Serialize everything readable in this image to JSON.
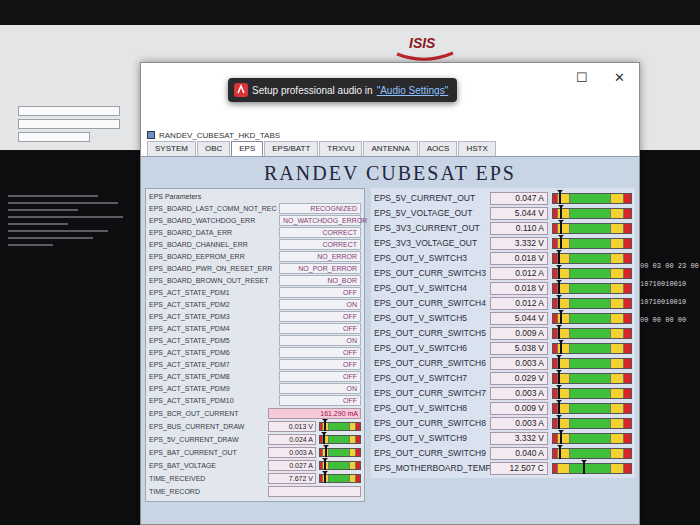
{
  "desktop": {
    "logo": "ISIS",
    "terminal_lines": [
      "00 03 00 23 00",
      "10710010010",
      "10710010010",
      "00 00 00 00"
    ]
  },
  "notification": {
    "text": "Setup professional audio in",
    "link": "\"Audio Settings\""
  },
  "window": {
    "title": "RANDEV_CUBESAT_HKD_TABS",
    "controls": [
      "☐",
      "✕"
    ]
  },
  "tabs": [
    {
      "label": "SYSTEM",
      "selected": false
    },
    {
      "label": "OBC",
      "selected": false
    },
    {
      "label": "EPS",
      "selected": true
    },
    {
      "label": "EPS/BATT",
      "selected": false
    },
    {
      "label": "TRXVU",
      "selected": false
    },
    {
      "label": "ANTENNA",
      "selected": false
    },
    {
      "label": "AOCS",
      "selected": false
    },
    {
      "label": "HSTX",
      "selected": false
    }
  ],
  "panel": {
    "title": "RANDEV CUBESAT EPS"
  },
  "parameters": {
    "header": "EPS Parameters",
    "rows": [
      {
        "label": "EPS_BOARD_LAST_COMM_NOT_REC",
        "value": "RECOGNIZED"
      },
      {
        "label": "EPS_BOARD_WATCHDOG_ERR",
        "value": "NO_WATCHDOG_ERROR"
      },
      {
        "label": "EPS_BOARD_DATA_ERR",
        "value": "CORRECT"
      },
      {
        "label": "EPS_BOARD_CHANNEL_ERR",
        "value": "CORRECT"
      },
      {
        "label": "EPS_BOARD_EEPROM_ERR",
        "value": "NO_ERROR"
      },
      {
        "label": "EPS_BOARD_PWR_ON_RESET_ERR",
        "value": "NO_POR_ERROR"
      },
      {
        "label": "EPS_BOARD_BROWN_OUT_RESET",
        "value": "NO_BOR"
      },
      {
        "label": "EPS_ACT_STATE_PDM1",
        "value": "OFF"
      },
      {
        "label": "EPS_ACT_STATE_PDM2",
        "value": "ON"
      },
      {
        "label": "EPS_ACT_STATE_PDM3",
        "value": "OFF"
      },
      {
        "label": "EPS_ACT_STATE_PDM4",
        "value": "OFF"
      },
      {
        "label": "EPS_ACT_STATE_PDM5",
        "value": "ON"
      },
      {
        "label": "EPS_ACT_STATE_PDM6",
        "value": "OFF"
      },
      {
        "label": "EPS_ACT_STATE_PDM7",
        "value": "OFF"
      },
      {
        "label": "EPS_ACT_STATE_PDM8",
        "value": "OFF"
      },
      {
        "label": "EPS_ACT_STATE_PDM9",
        "value": "ON"
      },
      {
        "label": "EPS_ACT_STATE_PDM10",
        "value": "OFF"
      }
    ],
    "readings": [
      {
        "label": "EPS_BCR_OUT_CURRENT",
        "value": "161.290 mA",
        "kind": "value",
        "alert": true
      },
      {
        "label": "EPS_BUS_CURRENT_DRAW",
        "value": "0.013 V",
        "kind": "meter",
        "alert": false,
        "level": 0.12
      },
      {
        "label": "EPS_5V_CURRENT_DRAW",
        "value": "0.024 A",
        "kind": "meter",
        "alert": false,
        "level": 0.1
      },
      {
        "label": "EPS_BAT_CURRENT_OUT",
        "value": "0.003 A",
        "kind": "meter",
        "alert": false,
        "level": 0.15
      },
      {
        "label": "EPS_BAT_VOLTAGE",
        "value": "0.027 A",
        "kind": "meter",
        "alert": false,
        "level": 0.12
      },
      {
        "label": "TIME_RECEIVED",
        "value": "7.672 V",
        "kind": "meter",
        "alert": false,
        "level": 0.12
      },
      {
        "label": "TIME_RECORD",
        "value": "",
        "kind": "value",
        "alert": false
      }
    ]
  },
  "outputs": [
    {
      "label": "EPS_5V_CURRENT_OUT",
      "value": "0.047 A",
      "level": 0.09
    },
    {
      "label": "EPS_5V_VOLTAGE_OUT",
      "value": "5.044 V",
      "level": 0.1
    },
    {
      "label": "EPS_3V3_CURRENT_OUT",
      "value": "0.110 A",
      "level": 0.1
    },
    {
      "label": "EPS_3V3_VOLTAGE_OUT",
      "value": "3.332 V",
      "level": 0.1
    },
    {
      "label": "EPS_OUT_V_SWITCH3",
      "value": "0.018 V",
      "level": 0.08
    },
    {
      "label": "EPS_OUT_CURR_SWITCH3",
      "value": "0.012 A",
      "level": 0.08
    },
    {
      "label": "EPS_OUT_V_SWITCH4",
      "value": "0.018 V",
      "level": 0.08
    },
    {
      "label": "EPS_OUT_CURR_SWITCH4",
      "value": "0.012 A",
      "level": 0.08
    },
    {
      "label": "EPS_OUT_V_SWITCH5",
      "value": "5.044 V",
      "level": 0.1
    },
    {
      "label": "EPS_OUT_CURR_SWITCH5",
      "value": "0.009 A",
      "level": 0.08
    },
    {
      "label": "EPS_OUT_V_SWITCH6",
      "value": "5.038 V",
      "level": 0.1
    },
    {
      "label": "EPS_OUT_CURR_SWITCH6",
      "value": "0.003 A",
      "level": 0.08
    },
    {
      "label": "EPS_OUT_V_SWITCH7",
      "value": "0.029 V",
      "level": 0.08
    },
    {
      "label": "EPS_OUT_CURR_SWITCH7",
      "value": "0.003 A",
      "level": 0.08
    },
    {
      "label": "EPS_OUT_V_SWITCH8",
      "value": "0.009 V",
      "level": 0.08
    },
    {
      "label": "EPS_OUT_CURR_SWITCH8",
      "value": "0.003 A",
      "level": 0.08
    },
    {
      "label": "EPS_OUT_V_SWITCH9",
      "value": "3.332 V",
      "level": 0.1
    },
    {
      "label": "EPS_OUT_CURR_SWITCH9",
      "value": "0.040 A",
      "level": 0.09
    },
    {
      "label": "EPS_MOTHERBOARD_TEMP",
      "value": "12.507 C",
      "level": 0.4
    }
  ]
}
